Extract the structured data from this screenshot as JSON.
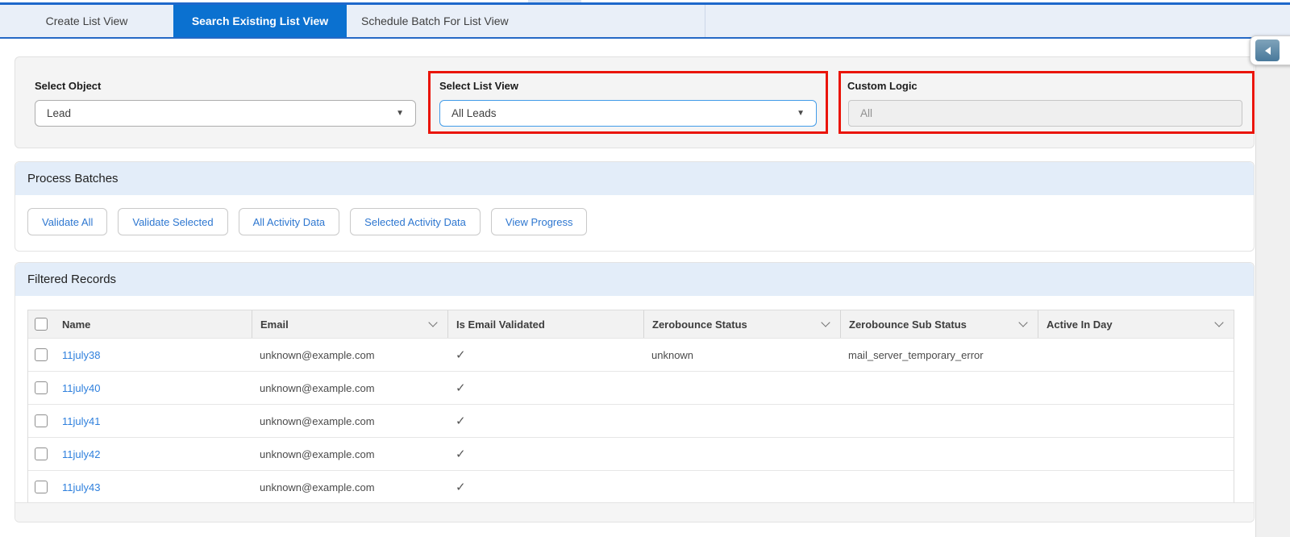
{
  "tabs": [
    {
      "label": "Create List View"
    },
    {
      "label": "Search Existing List View"
    },
    {
      "label": "Schedule Batch For List View"
    }
  ],
  "form": {
    "select_object": {
      "label": "Select Object",
      "value": "Lead"
    },
    "select_list_view": {
      "label": "Select List View",
      "value": "All Leads"
    },
    "custom_logic": {
      "label": "Custom Logic",
      "value": "All"
    }
  },
  "process_batches": {
    "title": "Process Batches",
    "buttons": [
      {
        "label": "Validate All"
      },
      {
        "label": "Validate Selected"
      },
      {
        "label": "All Activity Data"
      },
      {
        "label": "Selected Activity Data"
      },
      {
        "label": "View Progress"
      }
    ]
  },
  "filtered_records": {
    "title": "Filtered Records",
    "columns": {
      "name": "Name",
      "email": "Email",
      "is_email_validated": "Is Email Validated",
      "zerobounce_status": "Zerobounce Status",
      "zerobounce_sub_status": "Zerobounce Sub Status",
      "active_in_day": "Active In Day"
    },
    "rows": [
      {
        "name": "11july38",
        "email": "unknown@example.com",
        "is_email_validated": "✓",
        "zerobounce_status": "unknown",
        "zerobounce_sub_status": "mail_server_temporary_error",
        "active_in_day": ""
      },
      {
        "name": "11july40",
        "email": "unknown@example.com",
        "is_email_validated": "✓",
        "zerobounce_status": "",
        "zerobounce_sub_status": "",
        "active_in_day": ""
      },
      {
        "name": "11july41",
        "email": "unknown@example.com",
        "is_email_validated": "✓",
        "zerobounce_status": "",
        "zerobounce_sub_status": "",
        "active_in_day": ""
      },
      {
        "name": "11july42",
        "email": "unknown@example.com",
        "is_email_validated": "✓",
        "zerobounce_status": "",
        "zerobounce_sub_status": "",
        "active_in_day": ""
      },
      {
        "name": "11july43",
        "email": "unknown@example.com",
        "is_email_validated": "✓",
        "zerobounce_status": "",
        "zerobounce_sub_status": "",
        "active_in_day": ""
      }
    ]
  },
  "icons": {
    "dropdown_arrow": "▼"
  },
  "colors": {
    "active_tab": "#0b71d0",
    "tab_bar_bg": "#e9eff8",
    "top_line": "#1e68cb",
    "section_header_bg": "#e3edf9",
    "annotation_red": "#ea1408",
    "link_blue": "#2f80dd",
    "button_text_blue": "#2e77d0",
    "focused_select_border": "#419be8"
  }
}
